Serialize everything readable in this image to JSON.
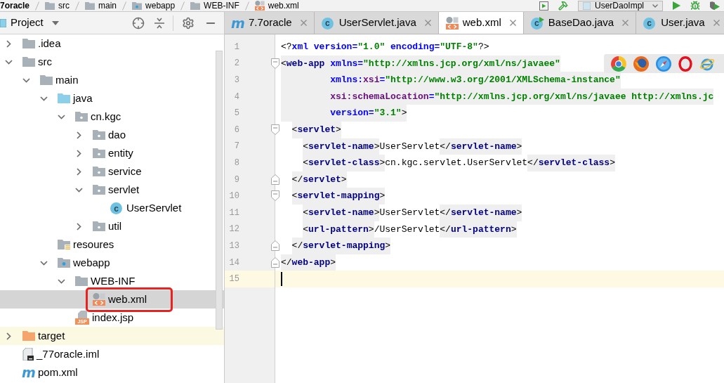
{
  "breadcrumb": [
    {
      "label": "7oracle",
      "kind": "project"
    },
    {
      "label": "src",
      "kind": "folder"
    },
    {
      "label": "main",
      "kind": "folder"
    },
    {
      "label": "webapp",
      "kind": "web-folder"
    },
    {
      "label": "WEB-INF",
      "kind": "folder"
    },
    {
      "label": "web.xml",
      "kind": "xml"
    }
  ],
  "run_configuration": {
    "label": "UserDaoImpl"
  },
  "project_panel": {
    "title": "Project",
    "tree": [
      {
        "label": ".idea",
        "kind": "folder",
        "expanded": false,
        "selected": false,
        "highlighted": false
      },
      {
        "label": "src",
        "kind": "folder",
        "expanded": true,
        "selected": false,
        "highlighted": false,
        "children": [
          {
            "label": "main",
            "kind": "folder",
            "expanded": true,
            "selected": false,
            "highlighted": false,
            "children": [
              {
                "label": "java",
                "kind": "source-folder",
                "expanded": true,
                "selected": false,
                "highlighted": false,
                "children": [
                  {
                    "label": "cn.kgc",
                    "kind": "package",
                    "expanded": true,
                    "selected": false,
                    "highlighted": false,
                    "children": [
                      {
                        "label": "dao",
                        "kind": "package",
                        "expanded": false,
                        "selected": false,
                        "highlighted": false
                      },
                      {
                        "label": "entity",
                        "kind": "package",
                        "expanded": false,
                        "selected": false,
                        "highlighted": false
                      },
                      {
                        "label": "service",
                        "kind": "package",
                        "expanded": false,
                        "selected": false,
                        "highlighted": false
                      },
                      {
                        "label": "servlet",
                        "kind": "package",
                        "expanded": true,
                        "selected": false,
                        "highlighted": false,
                        "children": [
                          {
                            "label": "UserServlet",
                            "kind": "class",
                            "icon_letter": "c",
                            "selected": false,
                            "highlighted": false
                          }
                        ]
                      },
                      {
                        "label": "util",
                        "kind": "package",
                        "expanded": false,
                        "selected": false,
                        "highlighted": false
                      }
                    ]
                  }
                ]
              },
              {
                "label": "resoures",
                "kind": "resources-folder",
                "selected": false,
                "highlighted": false
              },
              {
                "label": "webapp",
                "kind": "web-folder",
                "expanded": true,
                "selected": false,
                "highlighted": false,
                "children": [
                  {
                    "label": "WEB-INF",
                    "kind": "folder",
                    "expanded": true,
                    "selected": false,
                    "highlighted": false,
                    "children": [
                      {
                        "label": "web.xml",
                        "kind": "xml",
                        "selected": true,
                        "highlighted": true
                      }
                    ]
                  },
                  {
                    "label": "index.jsp",
                    "kind": "jsp",
                    "icon_letter": "JSP",
                    "selected": false,
                    "highlighted": false
                  }
                ]
              }
            ]
          }
        ]
      },
      {
        "label": "target",
        "kind": "excluded-folder",
        "expanded": false,
        "selected": false,
        "highlighted": false
      },
      {
        "label": "_77oracle.iml",
        "kind": "iml",
        "selected": false,
        "highlighted": false
      },
      {
        "label": "pom.xml",
        "kind": "maven",
        "icon_letter": "m",
        "selected": false,
        "highlighted": false
      }
    ]
  },
  "tabs": [
    {
      "label": "7.7oracle",
      "kind": "maven",
      "icon_letter": "m",
      "selected": false
    },
    {
      "label": "UserServlet.java",
      "kind": "class",
      "icon_letter": "c",
      "selected": false
    },
    {
      "label": "web.xml",
      "kind": "xml",
      "selected": true
    },
    {
      "label": "BaseDao.java",
      "kind": "runnable-class",
      "icon_letter": "c",
      "selected": false
    },
    {
      "label": "User.java",
      "kind": "class",
      "icon_letter": "c",
      "selected": false
    }
  ],
  "editor": {
    "lines": [
      {
        "number": "1",
        "current": false,
        "segments": [
          {
            "kind": "tag",
            "highlighted": false,
            "parts": [
              {
                "kind": "punct",
                "text": "<?"
              },
              {
                "kind": "attr",
                "text": "xml version="
              },
              {
                "kind": "value",
                "text": "\"1.0\""
              },
              {
                "kind": "attr",
                "text": " encoding="
              },
              {
                "kind": "value",
                "text": "\"UTF-8\""
              },
              {
                "kind": "punct",
                "text": "?>"
              }
            ]
          }
        ]
      },
      {
        "number": "2",
        "current": false,
        "fold": {
          "kind": "start"
        },
        "segments": [
          {
            "kind": "tag",
            "highlighted": true,
            "parts": [
              {
                "kind": "punct",
                "text": "<"
              },
              {
                "kind": "name",
                "text": "web-app"
              },
              {
                "kind": "attr",
                "text": " xmlns="
              },
              {
                "kind": "value",
                "text": "\"http://xmlns.jcp.org/xml/ns/javaee\""
              }
            ]
          }
        ]
      },
      {
        "number": "3",
        "current": false,
        "segments": [
          {
            "kind": "tag",
            "highlighted": true,
            "parts": [
              {
                "kind": "attr",
                "text": "         xmlns:"
              },
              {
                "kind": "ns",
                "text": "xsi"
              },
              {
                "kind": "attr",
                "text": "="
              },
              {
                "kind": "value",
                "text": "\"http://www.w3.org/2001/XMLSchema-instance\""
              }
            ]
          }
        ]
      },
      {
        "number": "4",
        "current": false,
        "segments": [
          {
            "kind": "tag",
            "highlighted": true,
            "parts": [
              {
                "kind": "ns",
                "text": "         xsi:schemaLocation"
              },
              {
                "kind": "attr",
                "text": "="
              },
              {
                "kind": "value",
                "text": "\"http://xmlns.jcp.org/xml/ns/javaee http://xmlns.jc"
              }
            ]
          }
        ]
      },
      {
        "number": "5",
        "current": false,
        "segments": [
          {
            "kind": "tag",
            "highlighted": true,
            "parts": [
              {
                "kind": "attr",
                "text": "         version="
              },
              {
                "kind": "value",
                "text": "\"3.1\""
              },
              {
                "kind": "punct",
                "text": ">"
              }
            ]
          }
        ]
      },
      {
        "number": "6",
        "current": false,
        "fold": {
          "kind": "start"
        },
        "segments": [
          {
            "kind": "tag",
            "highlighted": true,
            "parts": [
              {
                "kind": "punct",
                "text": "  <"
              },
              {
                "kind": "name",
                "text": "servlet"
              },
              {
                "kind": "punct",
                "text": ">"
              }
            ]
          }
        ]
      },
      {
        "number": "7",
        "current": false,
        "segments": [
          {
            "kind": "tag",
            "highlighted": true,
            "parts": [
              {
                "kind": "punct",
                "text": "    <"
              },
              {
                "kind": "name",
                "text": "servlet-name"
              },
              {
                "kind": "punct",
                "text": ">"
              }
            ]
          },
          {
            "kind": "text",
            "text": "UserServlet"
          },
          {
            "kind": "tag",
            "highlighted": true,
            "parts": [
              {
                "kind": "punct",
                "text": "</"
              },
              {
                "kind": "name",
                "text": "servlet-name"
              },
              {
                "kind": "punct",
                "text": ">"
              }
            ]
          }
        ]
      },
      {
        "number": "8",
        "current": false,
        "segments": [
          {
            "kind": "tag",
            "highlighted": true,
            "parts": [
              {
                "kind": "punct",
                "text": "    <"
              },
              {
                "kind": "name",
                "text": "servlet-class"
              },
              {
                "kind": "punct",
                "text": ">"
              }
            ]
          },
          {
            "kind": "text",
            "text": "cn.kgc.servlet.UserServlet"
          },
          {
            "kind": "tag",
            "highlighted": true,
            "parts": [
              {
                "kind": "punct",
                "text": "</"
              },
              {
                "kind": "name",
                "text": "servlet-class"
              },
              {
                "kind": "punct",
                "text": ">"
              }
            ]
          }
        ]
      },
      {
        "number": "9",
        "current": false,
        "fold": {
          "kind": "end"
        },
        "segments": [
          {
            "kind": "tag",
            "highlighted": true,
            "parts": [
              {
                "kind": "punct",
                "text": "  </"
              },
              {
                "kind": "name",
                "text": "servlet"
              },
              {
                "kind": "punct",
                "text": ">"
              }
            ]
          }
        ]
      },
      {
        "number": "10",
        "current": false,
        "fold": {
          "kind": "start"
        },
        "segments": [
          {
            "kind": "tag",
            "highlighted": true,
            "parts": [
              {
                "kind": "punct",
                "text": "  <"
              },
              {
                "kind": "name",
                "text": "servlet-mapping"
              },
              {
                "kind": "punct",
                "text": ">"
              }
            ]
          }
        ]
      },
      {
        "number": "11",
        "current": false,
        "segments": [
          {
            "kind": "tag",
            "highlighted": true,
            "parts": [
              {
                "kind": "punct",
                "text": "    <"
              },
              {
                "kind": "name",
                "text": "servlet-name"
              },
              {
                "kind": "punct",
                "text": ">"
              }
            ]
          },
          {
            "kind": "text",
            "text": "UserServlet"
          },
          {
            "kind": "tag",
            "highlighted": true,
            "parts": [
              {
                "kind": "punct",
                "text": "</"
              },
              {
                "kind": "name",
                "text": "servlet-name"
              },
              {
                "kind": "punct",
                "text": ">"
              }
            ]
          }
        ]
      },
      {
        "number": "12",
        "current": false,
        "segments": [
          {
            "kind": "tag",
            "highlighted": true,
            "parts": [
              {
                "kind": "punct",
                "text": "    <"
              },
              {
                "kind": "name",
                "text": "url-pattern"
              },
              {
                "kind": "punct",
                "text": ">"
              }
            ]
          },
          {
            "kind": "text",
            "text": "/UserServlet"
          },
          {
            "kind": "tag",
            "highlighted": true,
            "parts": [
              {
                "kind": "punct",
                "text": "</"
              },
              {
                "kind": "name",
                "text": "url-pattern"
              },
              {
                "kind": "punct",
                "text": ">"
              }
            ]
          }
        ]
      },
      {
        "number": "13",
        "current": false,
        "fold": {
          "kind": "end"
        },
        "segments": [
          {
            "kind": "tag",
            "highlighted": true,
            "parts": [
              {
                "kind": "punct",
                "text": "  </"
              },
              {
                "kind": "name",
                "text": "servlet-mapping"
              },
              {
                "kind": "punct",
                "text": ">"
              }
            ]
          }
        ]
      },
      {
        "number": "14",
        "current": false,
        "fold": {
          "kind": "end"
        },
        "segments": [
          {
            "kind": "tag",
            "highlighted": true,
            "parts": [
              {
                "kind": "punct",
                "text": "</"
              },
              {
                "kind": "name",
                "text": "web-app"
              },
              {
                "kind": "punct",
                "text": ">"
              }
            ]
          }
        ]
      },
      {
        "number": "15",
        "current": true
      }
    ]
  },
  "browser_popup": {
    "browsers": [
      {
        "kind": "chrome"
      },
      {
        "kind": "firefox"
      },
      {
        "kind": "safari"
      },
      {
        "kind": "opera"
      },
      {
        "kind": "ie"
      }
    ]
  }
}
